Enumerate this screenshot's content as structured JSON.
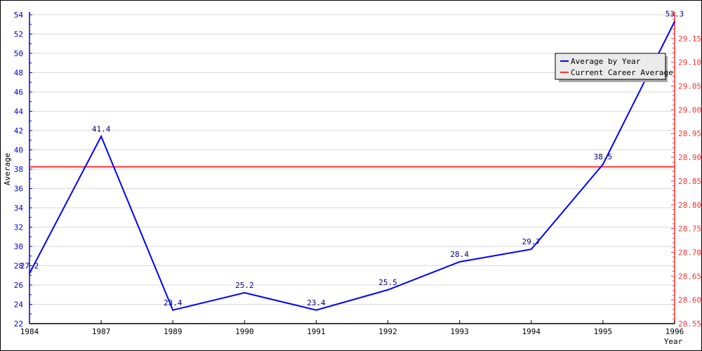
{
  "chart_data": {
    "type": "line",
    "title": "",
    "xlabel": "Year",
    "ylabel": "Average",
    "categories": [
      "1984",
      "1987",
      "1989",
      "1990",
      "1991",
      "1992",
      "1993",
      "1994",
      "1995",
      "1996"
    ],
    "series": [
      {
        "name": "Average by Year",
        "axis": "left",
        "color": "#0000ff",
        "values": [
          27.2,
          41.4,
          23.4,
          25.2,
          23.4,
          25.5,
          28.4,
          29.7,
          38.5,
          53.3
        ],
        "labels": [
          "27.2",
          "41.4",
          "23.4",
          "25.2",
          "23.4",
          "25.5",
          "28.4",
          "29.7",
          "38.5",
          "53.3"
        ]
      },
      {
        "name": "Current Career Average",
        "axis": "right",
        "color": "#ff3333",
        "constant": 28.88
      }
    ],
    "left_axis": {
      "ylim": [
        22,
        54
      ],
      "ticks": [
        "22",
        "24",
        "26",
        "28",
        "30",
        "32",
        "34",
        "36",
        "38",
        "40",
        "42",
        "44",
        "46",
        "48",
        "50",
        "52",
        "54"
      ],
      "color": "#0000cc"
    },
    "right_axis": {
      "ylim": [
        28.55,
        29.2
      ],
      "ticks": [
        "28.55",
        "28.60",
        "28.65",
        "28.70",
        "28.75",
        "28.80",
        "28.85",
        "28.90",
        "28.95",
        "29.00",
        "29.05",
        "29.10",
        "29.15"
      ],
      "color": "#ff3333"
    },
    "grid": true,
    "legend": {
      "position": "top-right",
      "entries": [
        "Average by Year",
        "Current Career Average"
      ]
    }
  }
}
